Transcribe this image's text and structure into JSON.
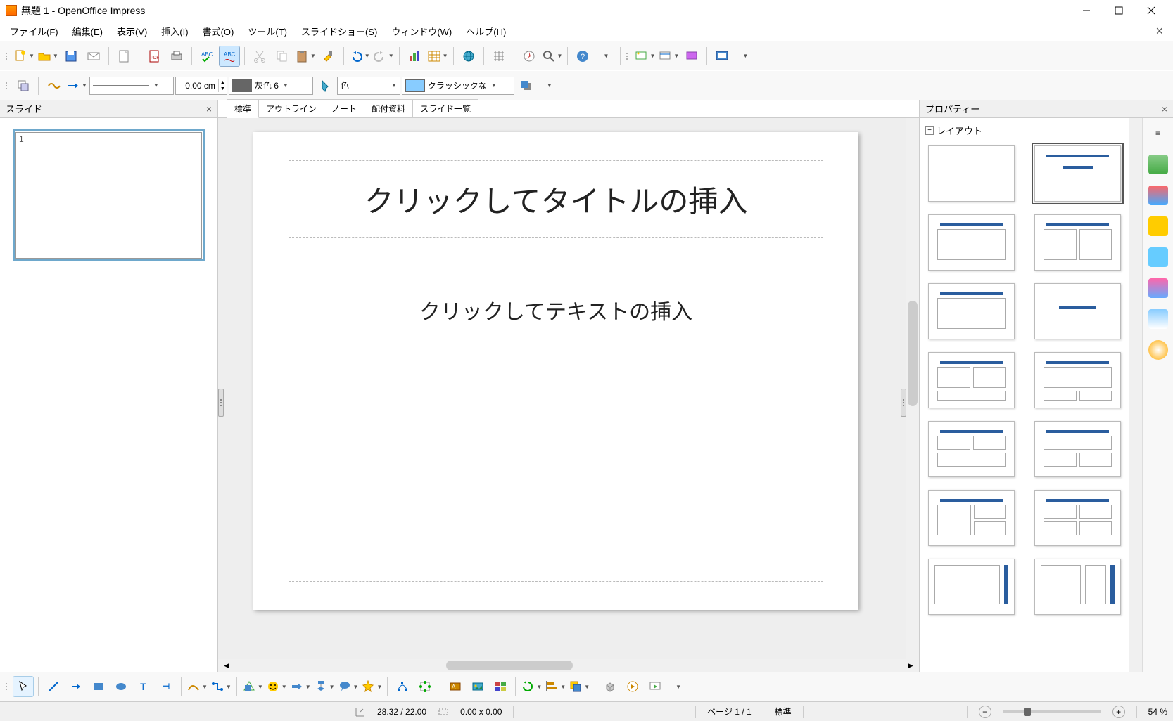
{
  "window": {
    "title": "無題 1 - OpenOffice Impress"
  },
  "menu": {
    "items": [
      "ファイル(F)",
      "編集(E)",
      "表示(V)",
      "挿入(I)",
      "書式(O)",
      "ツール(T)",
      "スライドショー(S)",
      "ウィンドウ(W)",
      "ヘルプ(H)"
    ]
  },
  "toolbar2": {
    "line_width": "0.00 cm",
    "line_color_label": "灰色 6",
    "fill_label": "色",
    "shadow_style": "クラッシックな"
  },
  "slide_panel": {
    "title": "スライド",
    "slide_number": "1"
  },
  "view_tabs": [
    "標準",
    "アウトライン",
    "ノート",
    "配付資料",
    "スライド一覧"
  ],
  "active_view_tab": 0,
  "slide": {
    "title_placeholder": "クリックしてタイトルの挿入",
    "content_placeholder": "クリックしてテキストの挿入"
  },
  "properties_panel": {
    "title": "プロパティー",
    "section": "レイアウト",
    "selected_layout_index": 1
  },
  "statusbar": {
    "position": "28.32 / 22.00",
    "size": "0.00 x 0.00",
    "page": "ページ 1 / 1",
    "mode": "標準",
    "zoom": "54 %"
  },
  "colors": {
    "accent": "#2a5d9e"
  }
}
